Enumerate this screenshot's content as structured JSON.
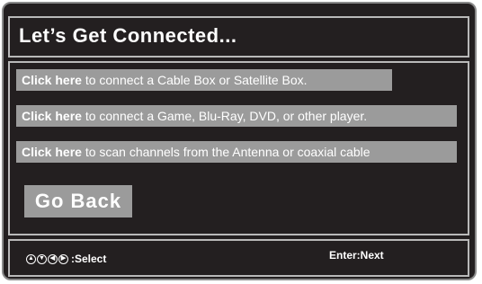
{
  "title": "Let’s Get Connected...",
  "options": [
    {
      "link": "Click here",
      "text": " to connect a Cable Box or Satellite Box."
    },
    {
      "link": "Click here",
      "text": " to connect a Game, Blu-Ray, DVD, or other player."
    },
    {
      "link": "Click here",
      "text": " to scan channels from the Antenna or coaxial cable"
    }
  ],
  "go_back_label": "Go Back",
  "footer": {
    "select_label": ":Select",
    "next_label": "Enter:Next",
    "nav_icons": [
      "up-arrow-icon",
      "down-arrow-icon",
      "left-arrow-icon",
      "right-arrow-icon"
    ]
  },
  "colors": {
    "background": "#231f20",
    "button": "#9b9b9b",
    "border": "#b9b9b9",
    "text": "#ffffff"
  }
}
